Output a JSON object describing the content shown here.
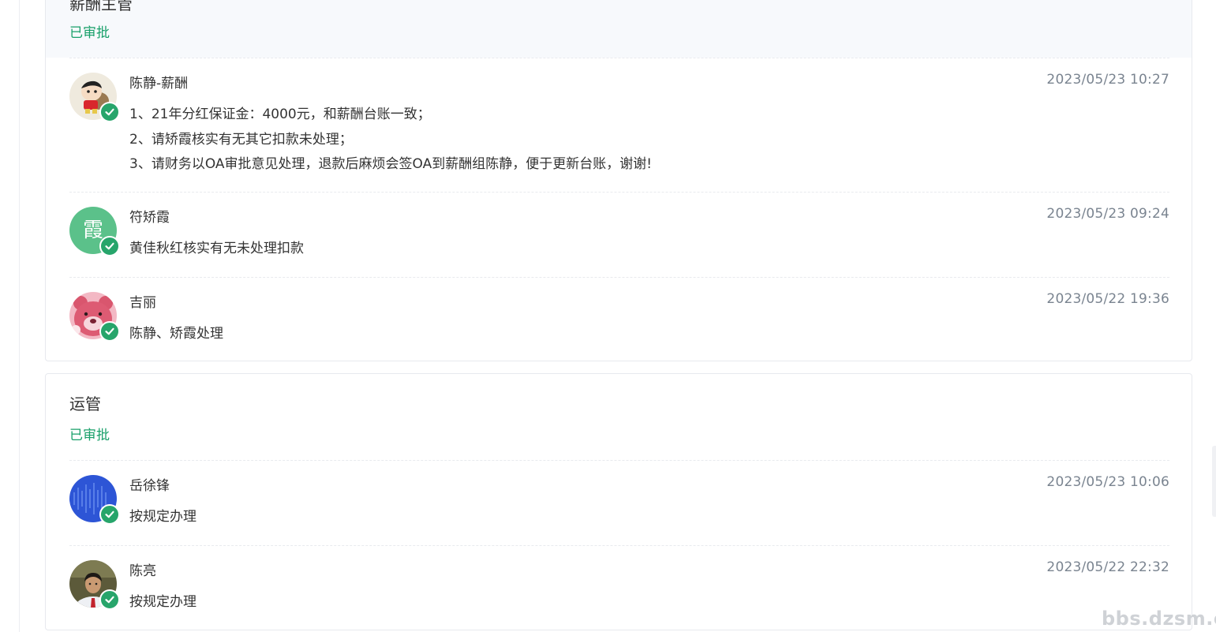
{
  "sections": [
    {
      "title": "薪酬主管",
      "status": "已审批",
      "entries": [
        {
          "name": "陈静-薪酬",
          "time": "2023/05/23 10:27",
          "comment_lines": [
            "1、21年分红保证金：4000元，和薪酬台账一致；",
            "2、请矫霞核实有无其它扣款未处理；",
            "3、请财务以OA审批意见处理，退款后麻烦会签OA到薪酬组陈静，便于更新台账，谢谢!"
          ]
        },
        {
          "name": "符矫霞",
          "avatar_text": "霞",
          "time": "2023/05/23 09:24",
          "comment_lines": [
            "黄佳秋红核实有无未处理扣款"
          ]
        },
        {
          "name": "吉丽",
          "time": "2023/05/22 19:36",
          "comment_lines": [
            "陈静、矫霞处理"
          ]
        }
      ]
    },
    {
      "title": "运管",
      "status": "已审批",
      "entries": [
        {
          "name": "岳徐锋",
          "time": "2023/05/23 10:06",
          "comment_lines": [
            "按规定办理"
          ]
        },
        {
          "name": "陈亮",
          "time": "2023/05/22 22:32",
          "comment_lines": [
            "按规定办理"
          ]
        }
      ]
    }
  ],
  "watermark": "bbs.dzsm.com",
  "colors": {
    "approved_green": "#19a06a",
    "check_badge": "#27a56b",
    "header_bg": "#f7f9fc",
    "timestamp": "#7a8490"
  },
  "icons": {
    "approved_badge": "check-circle-icon"
  }
}
